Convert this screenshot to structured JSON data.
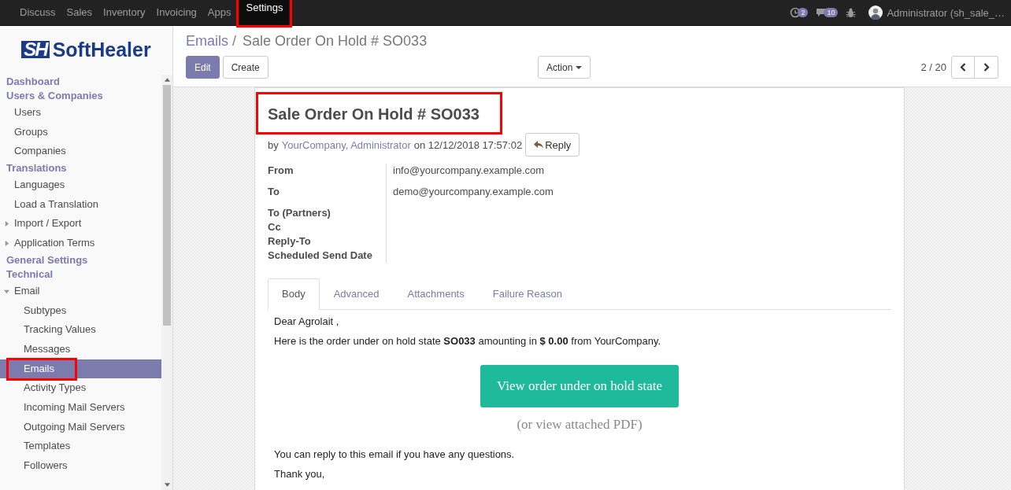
{
  "top_menu": [
    {
      "label": "Discuss",
      "selected": false
    },
    {
      "label": "Sales",
      "selected": false
    },
    {
      "label": "Inventory",
      "selected": false
    },
    {
      "label": "Invoicing",
      "selected": false
    },
    {
      "label": "Apps",
      "selected": false
    },
    {
      "label": "Settings",
      "selected": true,
      "highlighted": true
    }
  ],
  "systray": {
    "activity_count": "2",
    "message_count": "10",
    "user": "Administrator (sh_sale_…"
  },
  "sidebar": {
    "logo": {
      "mark": "SH",
      "name": "SoftHealer"
    },
    "items": [
      {
        "label": "Dashboard",
        "kind": "header",
        "selected": false
      },
      {
        "label": "Users & Companies",
        "kind": "header",
        "selected": false
      },
      {
        "label": "Users",
        "kind": "item",
        "selected": false
      },
      {
        "label": "Groups",
        "kind": "item",
        "selected": false
      },
      {
        "label": "Companies",
        "kind": "item",
        "selected": false
      },
      {
        "label": "Translations",
        "kind": "header",
        "selected": false
      },
      {
        "label": "Languages",
        "kind": "item",
        "selected": false
      },
      {
        "label": "Load a Translation",
        "kind": "item",
        "selected": false
      },
      {
        "label": "Import / Export",
        "kind": "folder",
        "expanded": false,
        "selected": false
      },
      {
        "label": "Application Terms",
        "kind": "folder",
        "expanded": false,
        "selected": false
      },
      {
        "label": "General Settings",
        "kind": "header",
        "selected": false
      },
      {
        "label": "Technical",
        "kind": "header",
        "selected": false
      },
      {
        "label": "Email",
        "kind": "folder",
        "expanded": true,
        "selected": false,
        "children": [
          {
            "label": "Subtypes",
            "selected": false
          },
          {
            "label": "Tracking Values",
            "selected": false
          },
          {
            "label": "Messages",
            "selected": false
          },
          {
            "label": "Emails",
            "selected": true,
            "highlighted": true
          },
          {
            "label": "Activity Types",
            "selected": false
          },
          {
            "label": "Incoming Mail Servers",
            "selected": false
          },
          {
            "label": "Outgoing Mail Servers",
            "selected": false
          },
          {
            "label": "Templates",
            "selected": false
          },
          {
            "label": "Followers",
            "selected": false
          }
        ]
      }
    ]
  },
  "breadcrumb": {
    "parent": "Emails /",
    "current": "Sale Order On Hold # SO033"
  },
  "buttons": {
    "edit": "Edit",
    "create": "Create",
    "action": "Action"
  },
  "pager": "2 / 20",
  "email": {
    "title": "Sale Order On Hold # SO033",
    "title_highlighted": true,
    "by": "by",
    "authors": "YourCompany, Administrator",
    "date": "on 12/12/2018 17:57:02",
    "reply": "Reply",
    "fields": [
      {
        "label": "From",
        "value": "info@yourcompany.example.com"
      },
      {
        "label": "To",
        "value": "demo@yourcompany.example.com"
      },
      {
        "label": "To (Partners)"
      },
      {
        "label": "Cc"
      },
      {
        "label": "Reply-To"
      },
      {
        "label": "Scheduled Send Date"
      }
    ],
    "tabs": [
      {
        "label": "Body",
        "selected": true
      },
      {
        "label": "Advanced",
        "selected": false
      },
      {
        "label": "Attachments",
        "selected": false
      },
      {
        "label": "Failure Reason",
        "selected": false
      }
    ],
    "body": {
      "greeting": "Dear Agrolait ,",
      "intro": "Here is the order under on hold state **SO033** amounting in **$ 0.00** from YourCompany.",
      "cta": "View order under on hold state",
      "pdf": "(or view attached PDF)",
      "reply_note": "You can reply to this email if you have any questions.",
      "closing": "Thank you,"
    }
  }
}
